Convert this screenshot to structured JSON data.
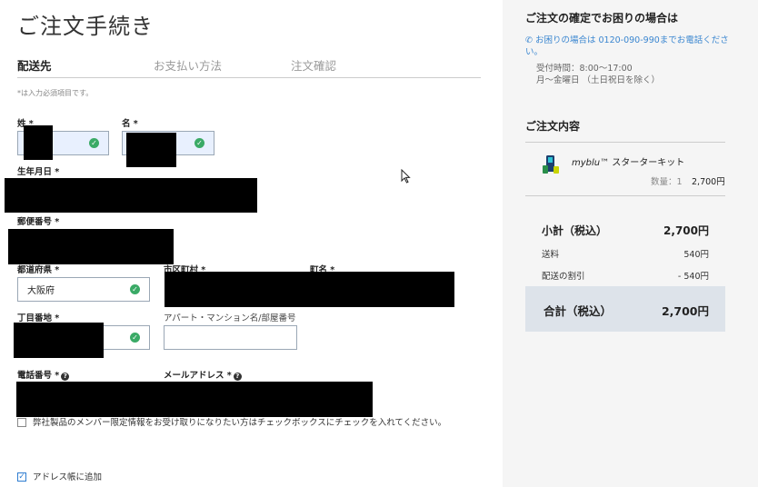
{
  "page": {
    "title": "ご注文手続き",
    "required_note": "*は入力必須項目です。"
  },
  "steps": [
    {
      "label": "配送先",
      "active": true
    },
    {
      "label": "お支払い方法",
      "active": false
    },
    {
      "label": "注文確認",
      "active": false
    }
  ],
  "form": {
    "last_name_label": "姓 *",
    "first_name_label": "名 *",
    "birthdate_label": "生年月日 *",
    "postal_label": "郵便番号 *",
    "prefecture_label": "都道府県 *",
    "prefecture_value": "大阪府",
    "city_label": "市区町村 *",
    "town_label": "町名 *",
    "chome_label": "丁目番地 *",
    "apartment_label": "アパート・マンション名/部屋番号",
    "apartment_value": "",
    "phone_label": "電話番号 *",
    "email_label": "メールアドレス *",
    "member_info_text": "弊社製品のメンバー限定情報をお受け取りになりたい方はチェックボックスにチェックを入れてください。",
    "member_info_checked": false,
    "address_book_text": "アドレス帳に追加",
    "address_book_checked": true
  },
  "help": {
    "title": "ご注文の確定でお困りの場合は",
    "phone_text": "お困りの場合は 0120-090-990までお電話ください。",
    "hours_line1": "受付時間：8:00～17:00",
    "hours_line2": "月～金曜日 （土日祝日を除く）"
  },
  "order": {
    "title": "ご注文内容",
    "product_brand": "myblu™",
    "product_name": " スターターキット",
    "qty_text": "数量：1",
    "price": "2,700円",
    "subtotal_label": "小計（税込）",
    "subtotal_value": "2,700円",
    "shipping_label": "送料",
    "shipping_value": "540円",
    "discount_label": "配送の割引",
    "discount_value": "- 540円",
    "total_label": "合計（税込）",
    "total_value": "2,700円"
  },
  "colors": {
    "accent": "#3a86d0",
    "valid": "#3aaa66",
    "total_bg": "#dde3ea",
    "panel_bg": "#f5f5f5"
  }
}
